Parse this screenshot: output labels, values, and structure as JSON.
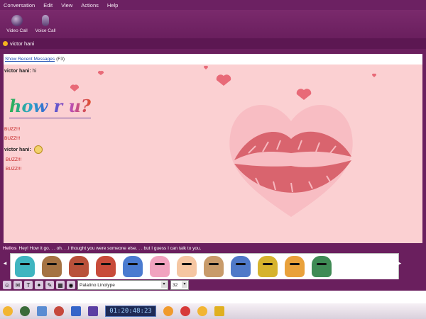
{
  "menu": [
    "Conversation",
    "Edit",
    "View",
    "Actions",
    "Help"
  ],
  "toolbar": {
    "video_label": "Video Call",
    "voice_label": "Voice Call"
  },
  "contact": {
    "name": "victor hani",
    "status_color": "#f4b21f"
  },
  "recent": {
    "link": "Show Recent Messages",
    "shortcut": "(F3)"
  },
  "messages": {
    "sender1": "victor hani:",
    "text1": "hi",
    "howru": "how r u?",
    "buzz1": "BUZZ!!!",
    "buzz2": "BUZZ!!!",
    "sender2": "victor hani:",
    "buzz3": "BUZZ!!!",
    "buzz4": "BUZZ!!!"
  },
  "nudge": {
    "hello": "Hellos",
    "text": "Hey! How it go. . . oh. . .I thought you were someone else. . . but I guess I can talk to you."
  },
  "format": {
    "font": "Palatino Linotype",
    "size": "32"
  },
  "taskbar": {
    "clock": "01:20:48:23"
  },
  "colors": {
    "frame": "#6a1f5e",
    "chat_bg": "#fbd0d2",
    "link": "#1f4fb3",
    "buzz": "#c21a1a"
  },
  "emoticons": [
    {
      "name": "girl-green-hat",
      "color": "#3fb5c0"
    },
    {
      "name": "man-mustache",
      "color": "#a57343"
    },
    {
      "name": "zombie",
      "color": "#b9513a"
    },
    {
      "name": "man-cap",
      "color": "#c84b3a"
    },
    {
      "name": "kid-blue-hat",
      "color": "#4a7bd0"
    },
    {
      "name": "pig-face",
      "color": "#f1a3bf"
    },
    {
      "name": "baby",
      "color": "#f5c6a2"
    },
    {
      "name": "dog",
      "color": "#c89b6a"
    },
    {
      "name": "blue-bunny",
      "color": "#4f79c8"
    },
    {
      "name": "robot",
      "color": "#d6b32d"
    },
    {
      "name": "orange-hair",
      "color": "#e9a13b"
    },
    {
      "name": "green-girl",
      "color": "#3f8b55"
    }
  ]
}
